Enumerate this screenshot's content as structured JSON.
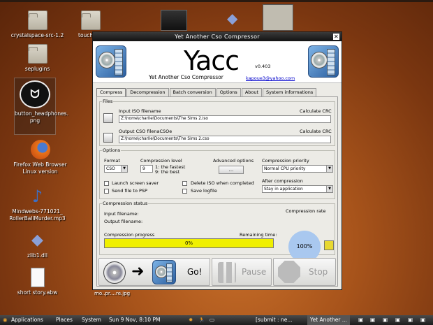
{
  "desktop": {
    "icons": [
      {
        "label": "crystalspace-src-1.2",
        "icon": "folder-icon"
      },
      {
        "label": "seplugins",
        "icon": "folder-icon"
      },
      {
        "label": "button_headphones.\npng",
        "icon": "headphones-image-icon"
      },
      {
        "label": "Firefox Web Browser\nLinux version",
        "icon": "firefox-icon"
      },
      {
        "label": "Mindwebs-771021_\nRollerBallMurder.mp3",
        "icon": "music-note-icon"
      },
      {
        "label": "zlib1.dll",
        "icon": "diamond-icon"
      },
      {
        "label": "short story.abw",
        "icon": "document-icon"
      },
      {
        "label": "touch",
        "icon": "folder-icon"
      }
    ],
    "partial_label": "mo..pr....re.jpg"
  },
  "window": {
    "title": "Yet Another Cso Compressor",
    "logo": "Yacc",
    "version": "v0.403",
    "subtitle": "Yet Another Cso Compressor",
    "email": "kapoue3@yahoo.com",
    "tabs": [
      "Compress",
      "Decompression",
      "Batch conversion",
      "Options",
      "About",
      "System informations"
    ],
    "files": {
      "group": "Files",
      "input_label": "Input ISO filename",
      "input_value": "Z:\\home\\charlie\\Documents\\The Sims 2.iso",
      "crc1": "Calculate CRC",
      "output_label": "Output CSO filenaCSOe",
      "output_value": "Z:\\home\\charlie\\Documents\\The Sims 2.cso",
      "crc2": "Calculate CRC"
    },
    "options": {
      "group": "Options",
      "format_label": "Format",
      "format_value": "CSO",
      "level_label": "Compression level",
      "level_value": "9",
      "level_hint1": "1: the fastest",
      "level_hint2": "9: the best",
      "adv_label": "Advanced options",
      "adv_button": "...",
      "priority_label": "Compression priority",
      "priority_value": "Normal CPU priority",
      "after_label": "After compression",
      "after_value": "Stay in application",
      "cb_screensaver": "Launch screen saver",
      "cb_psp": "Send file to PSP",
      "cb_delete": "Delete ISO when completed",
      "cb_log": "Save logfile"
    },
    "status": {
      "group": "Compression status",
      "input_fn": "Input filename:",
      "output_fn": "Output filename:",
      "rate_label": "Compression rate",
      "rate_value": "100%",
      "progress_label": "Compression progress",
      "remaining_label": "Remaining time:",
      "progress_text": "0%",
      "progress": 0
    },
    "actions": {
      "go": "Go!",
      "pause": "Pause",
      "stop": "Stop"
    }
  },
  "taskbar": {
    "applications": "Applications",
    "places": "Places",
    "system": "System",
    "clock": "Sun  9 Nov,  8:10 PM",
    "task1": "[submit : ne...",
    "task2": "Yet Another ..."
  },
  "colors": {
    "progress_fill": "#f0f000",
    "rate_circle": "#a9c8ef",
    "titlebar": "#121212"
  }
}
